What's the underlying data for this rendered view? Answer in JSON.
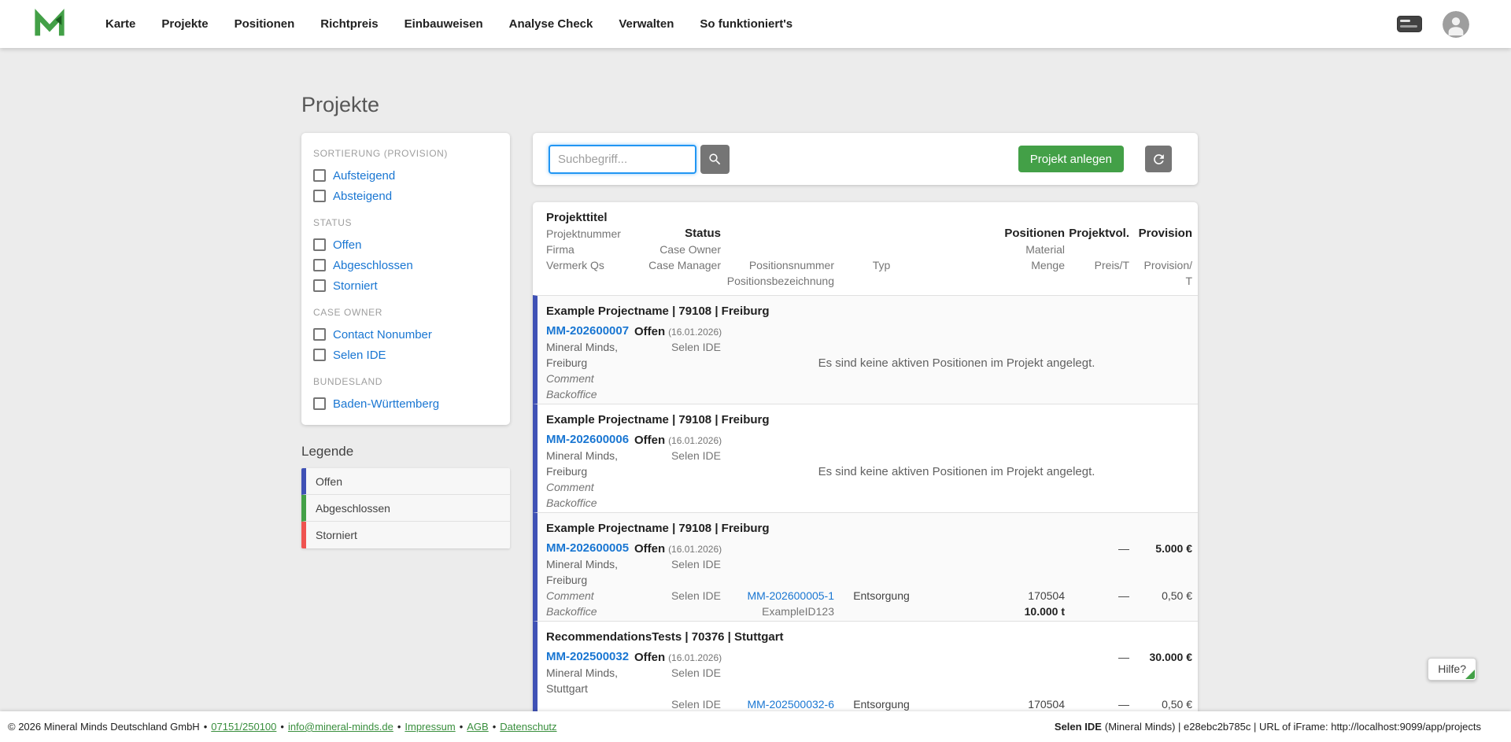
{
  "colors": {
    "accent_green": "#43a047",
    "link_blue": "#1976d2",
    "status_offen": "#3f51b5",
    "status_abgeschlossen": "#43a047",
    "status_storniert": "#ef5350",
    "search_focus_blue": "#2196f3"
  },
  "icons": {
    "logo": "mineral-minds-logo",
    "navbar_right": [
      "sessions-icon",
      "user-avatar"
    ],
    "search": "magnifier-icon",
    "refresh": "refresh-icon",
    "filter": "empty-checkbox"
  },
  "nav": {
    "items": [
      {
        "label": "Karte"
      },
      {
        "label": "Projekte"
      },
      {
        "label": "Positionen"
      },
      {
        "label": "Richtpreis"
      },
      {
        "label": "Einbauweisen"
      },
      {
        "label": "Analyse Check"
      },
      {
        "label": "Verwalten"
      },
      {
        "label": "So funktioniert's"
      }
    ]
  },
  "page": {
    "title": "Projekte"
  },
  "sidebar": {
    "sections": [
      {
        "label": "SORTIERUNG (PROVISION)",
        "options": [
          {
            "label": "Aufsteigend"
          },
          {
            "label": "Absteigend"
          }
        ]
      },
      {
        "label": "STATUS",
        "options": [
          {
            "label": "Offen"
          },
          {
            "label": "Abgeschlossen"
          },
          {
            "label": "Storniert"
          }
        ]
      },
      {
        "label": "CASE OWNER",
        "options": [
          {
            "label": "Contact Nonumber"
          },
          {
            "label": "Selen IDE"
          }
        ]
      },
      {
        "label": "BUNDESLAND",
        "options": [
          {
            "label": "Baden-Württemberg"
          }
        ]
      }
    ],
    "legend": {
      "title": "Legende",
      "items": [
        {
          "label": "Offen",
          "color": "#3f51b5"
        },
        {
          "label": "Abgeschlossen",
          "color": "#43a047"
        },
        {
          "label": "Storniert",
          "color": "#ef5350"
        }
      ]
    }
  },
  "toolbar": {
    "search_placeholder": "Suchbegriff...",
    "create_button": "Projekt anlegen"
  },
  "table": {
    "header": {
      "projekttitel": "Projekttitel",
      "projektnummer": "Projektnummer",
      "firma": "Firma",
      "vermerk": "Vermerk Qs",
      "status": "Status",
      "case_owner": "Case Owner",
      "case_manager": "Case Manager",
      "positionsnummer": "Positionsnummer",
      "positionsbezeichnung": "Positionsbezeichnung",
      "typ": "Typ",
      "positionen": "Positionen",
      "material": "Material",
      "menge": "Menge",
      "projektvol": "Projektvol.",
      "preis_t": "Preis/T",
      "provision": "Provision",
      "provision_t_line1": "Provision/",
      "provision_t_line2": "T"
    },
    "rows": [
      {
        "title": "Example Projectname | 79108 | Freiburg",
        "number": "MM-202600007",
        "status": "Offen",
        "status_date": "(16.01.2026)",
        "case_owner": "Selen IDE",
        "company_line1": "Mineral Minds,",
        "company_line2": "Freiburg",
        "note1": "Comment",
        "note2": "Backoffice",
        "empty_message": "Es sind keine aktiven Positionen im Projekt angelegt."
      },
      {
        "title": "Example Projectname | 79108 | Freiburg",
        "number": "MM-202600006",
        "status": "Offen",
        "status_date": "(16.01.2026)",
        "case_owner": "Selen IDE",
        "company_line1": "Mineral Minds,",
        "company_line2": "Freiburg",
        "note1": "Comment",
        "note2": "Backoffice",
        "empty_message": "Es sind keine aktiven Positionen im Projekt angelegt."
      },
      {
        "title": "Example Projectname | 79108 | Freiburg",
        "number": "MM-202600005",
        "status": "Offen",
        "status_date": "(16.01.2026)",
        "case_owner": "Selen IDE",
        "company_line1": "Mineral Minds,",
        "company_line2": "Freiburg",
        "note1": "Comment",
        "note2": "Backoffice",
        "preis_dash": "—",
        "provision_total": "5.000 €",
        "position": {
          "case_manager": "Selen IDE",
          "number": "MM-202600005-1",
          "id": "ExampleID123",
          "typ": "Entsorgung",
          "material": "170504",
          "menge": "10.000 t",
          "preis": "—",
          "provision": "0,50 €"
        }
      },
      {
        "title": "RecommendationsTests | 70376 | Stuttgart",
        "number": "MM-202500032",
        "status": "Offen",
        "status_date": "(16.01.2026)",
        "case_owner": "Selen IDE",
        "company_line1": "Mineral Minds,",
        "company_line2": "Stuttgart",
        "preis_dash": "—",
        "provision_total": "30.000 €",
        "position": {
          "case_manager": "Selen IDE",
          "number": "MM-202500032-6",
          "typ": "Entsorgung",
          "material": "170504",
          "preis": "—",
          "provision": "0,50 €"
        }
      }
    ]
  },
  "help": {
    "label": "Hilfe?"
  },
  "footer": {
    "copyright": "© 2026 Mineral Minds Deutschland GmbH",
    "separator": "•",
    "phone": "07151/250100",
    "email": "info@mineral-minds.de",
    "impressum": "Impressum",
    "agb": "AGB",
    "datenschutz": "Datenschutz",
    "session_user": "Selen IDE",
    "session_rest": "(Mineral Minds) | e28ebc2b785c | URL of iFrame: http://localhost:9099/app/projects"
  }
}
